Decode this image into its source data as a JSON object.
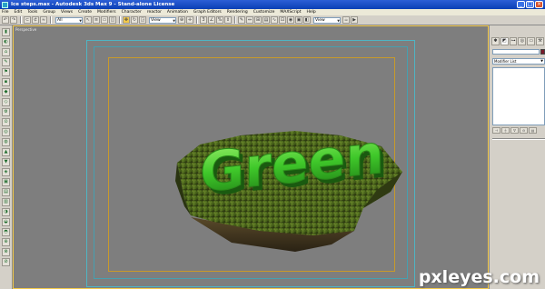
{
  "window": {
    "title": "Ice steps.max - Autodesk 3ds Max 9 - Stand-alone License",
    "minimize": "_",
    "maximize": "□",
    "close": "×"
  },
  "menu": [
    "File",
    "Edit",
    "Tools",
    "Group",
    "Views",
    "Create",
    "Modifiers",
    "Character",
    "reactor",
    "Animation",
    "Graph Editors",
    "Rendering",
    "Customize",
    "MAXScript",
    "Help"
  ],
  "toolbar": {
    "selection_filter": "All",
    "reference_coord": "View",
    "named_selection": "View"
  },
  "viewport": {
    "label": "Perspective",
    "text_object": "Green",
    "text_color": "#3fc82a"
  },
  "command_panel": {
    "object_name": "",
    "modifier_list": "Modifier List",
    "object_color": "#7a1a2a"
  },
  "watermark": "pxleyes.com",
  "colors": {
    "title_bar": "#0a3fb5",
    "viewport_bg": "#7e7e7e",
    "active_border": "#f2c94a",
    "safe_frame": "#4fb5c4",
    "action_safe": "#c89a2a"
  }
}
